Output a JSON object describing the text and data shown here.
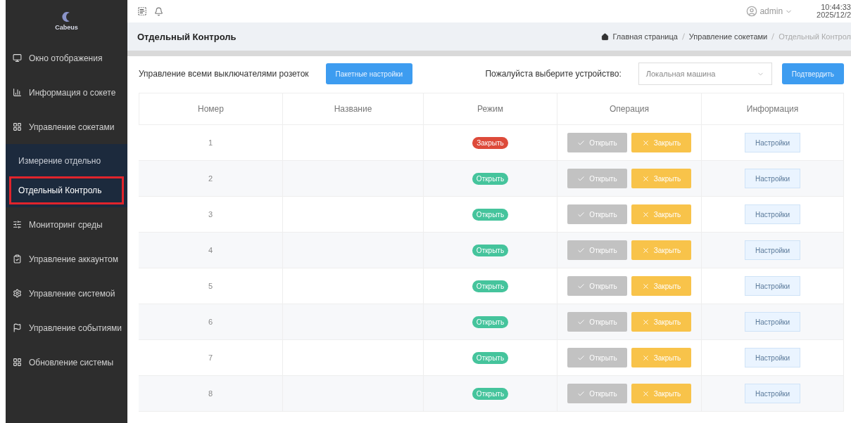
{
  "sidebar": {
    "logo": "Cabeus",
    "items": [
      {
        "label": "Окно отображения"
      },
      {
        "label": "Информация о сокете"
      },
      {
        "label": "Управление сокетами",
        "children": [
          {
            "label": "Измерение отдельно",
            "selected": false
          },
          {
            "label": "Отдельный Контроль",
            "selected": true
          }
        ]
      },
      {
        "label": "Мониторинг среды"
      },
      {
        "label": "Управление аккаунтом"
      },
      {
        "label": "Управление системой"
      },
      {
        "label": "Управление событиями"
      },
      {
        "label": "Обновление системы"
      }
    ]
  },
  "topbar": {
    "user": "admin",
    "time": "10:44:33",
    "date": "2025/12/2"
  },
  "page_title": "Отдельный Контроль",
  "breadcrumb": [
    "Главная страница",
    "Управление сокетами",
    "Отдельный Контрол"
  ],
  "toolbar": {
    "label": "Управление всеми выключателями розеток",
    "batch_button": "Пакетные настройки",
    "device_label": "Пожалуйста выберите устройство:",
    "device_value": "Локальная машина",
    "confirm_button": "Подтвердить"
  },
  "table": {
    "columns": [
      "Номер",
      "Название",
      "Режим",
      "Операция",
      "Информация"
    ],
    "rows": [
      {
        "number": "1",
        "mode": {
          "label": "Закрыть",
          "kind": "closed"
        },
        "open": "Открыть",
        "close": "Закрыть",
        "info": "Настройки"
      },
      {
        "number": "2",
        "mode": {
          "label": "Открыть",
          "kind": "open"
        },
        "open": "Открыть",
        "close": "Закрыть",
        "info": "Настройки"
      },
      {
        "number": "3",
        "mode": {
          "label": "Открыть",
          "kind": "open"
        },
        "open": "Открыть",
        "close": "Закрыть",
        "info": "Настройки"
      },
      {
        "number": "4",
        "mode": {
          "label": "Открыть",
          "kind": "open"
        },
        "open": "Открыть",
        "close": "Закрыть",
        "info": "Настройки"
      },
      {
        "number": "5",
        "mode": {
          "label": "Открыть",
          "kind": "open"
        },
        "open": "Открыть",
        "close": "Закрыть",
        "info": "Настройки"
      },
      {
        "number": "6",
        "mode": {
          "label": "Открыть",
          "kind": "open"
        },
        "open": "Открыть",
        "close": "Закрыть",
        "info": "Настройки"
      },
      {
        "number": "7",
        "mode": {
          "label": "Открыть",
          "kind": "open"
        },
        "open": "Открыть",
        "close": "Закрыть",
        "info": "Настройки"
      },
      {
        "number": "8",
        "mode": {
          "label": "Открыть",
          "kind": "open"
        },
        "open": "Открыть",
        "close": "Закрыть",
        "info": "Настройки"
      }
    ]
  }
}
